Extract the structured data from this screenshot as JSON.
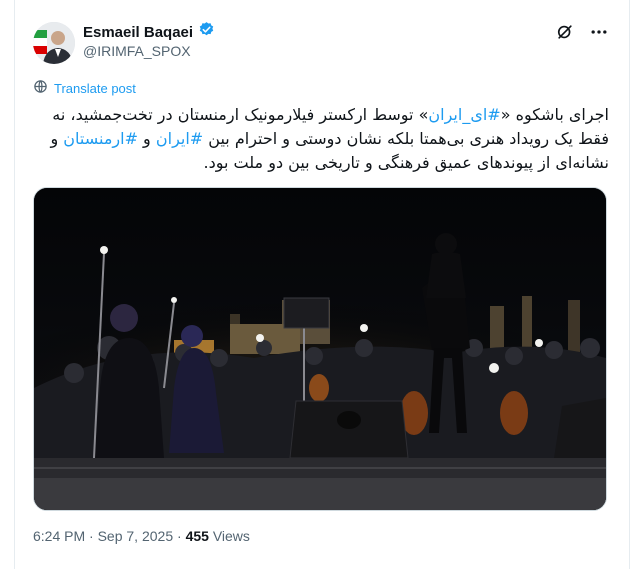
{
  "post": {
    "author_name": "Esmaeil Baqaei",
    "handle": "@IRIMFA_SPOX",
    "translate_label": "Translate post",
    "text_line1_a": "اجرای باشکوه «",
    "hashtag_1": "#ای_ایران",
    "text_line1_b": "» توسط ارکستر فیلارمونیک ارمنستان در تخت‌جمشید، نه",
    "text_line2_a": "فقط یک رویداد هنری بی‌همتا بلکه نشان دوستی و احترام بین ",
    "hashtag_2": "#ایران",
    "text_line2_b": " و ",
    "hashtag_3": "#ارمنستان",
    "text_line2_c": " و",
    "text_line3": "نشانه‌ای از پیوندهای عمیق فرهنگی و تاریخی بین دو ملت بود.",
    "time": "6:24 PM",
    "separator": " · ",
    "date": "Sep 7, 2025",
    "views_count": "455",
    "views_label": "Views"
  },
  "colors": {
    "link": "#1d9bf0",
    "verified": "#1d9bf0",
    "muted": "#536471",
    "text": "#0f1419"
  },
  "icons": [
    "verified-badge-icon",
    "grok-icon",
    "more-icon",
    "globe-icon"
  ]
}
